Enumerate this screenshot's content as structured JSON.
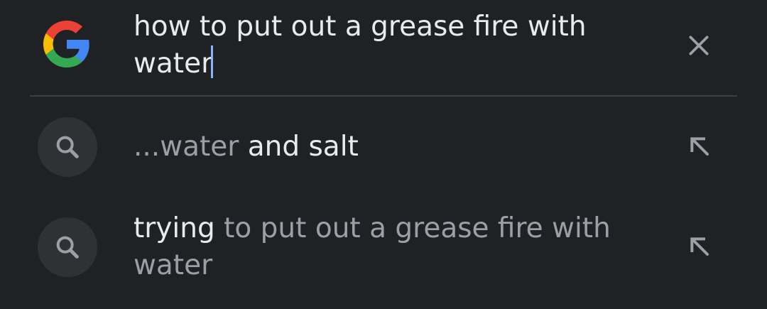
{
  "search": {
    "query": "how to put out a grease fire with water",
    "clear_icon": "close-icon",
    "logo_icon": "google-g-icon"
  },
  "suggestions": [
    {
      "icon": "search-icon",
      "prefix": "...water",
      "completion": " and salt",
      "action_icon": "arrow-up-left-icon"
    },
    {
      "icon": "search-icon",
      "prefix": "trying",
      "completion": " to put out a grease fire with water",
      "action_icon": "arrow-up-left-icon"
    }
  ],
  "colors": {
    "background": "#202124",
    "text_primary": "#e8eaed",
    "text_secondary": "#9aa0a6",
    "caret": "#8ab4f8",
    "icon_circle": "#303134"
  }
}
